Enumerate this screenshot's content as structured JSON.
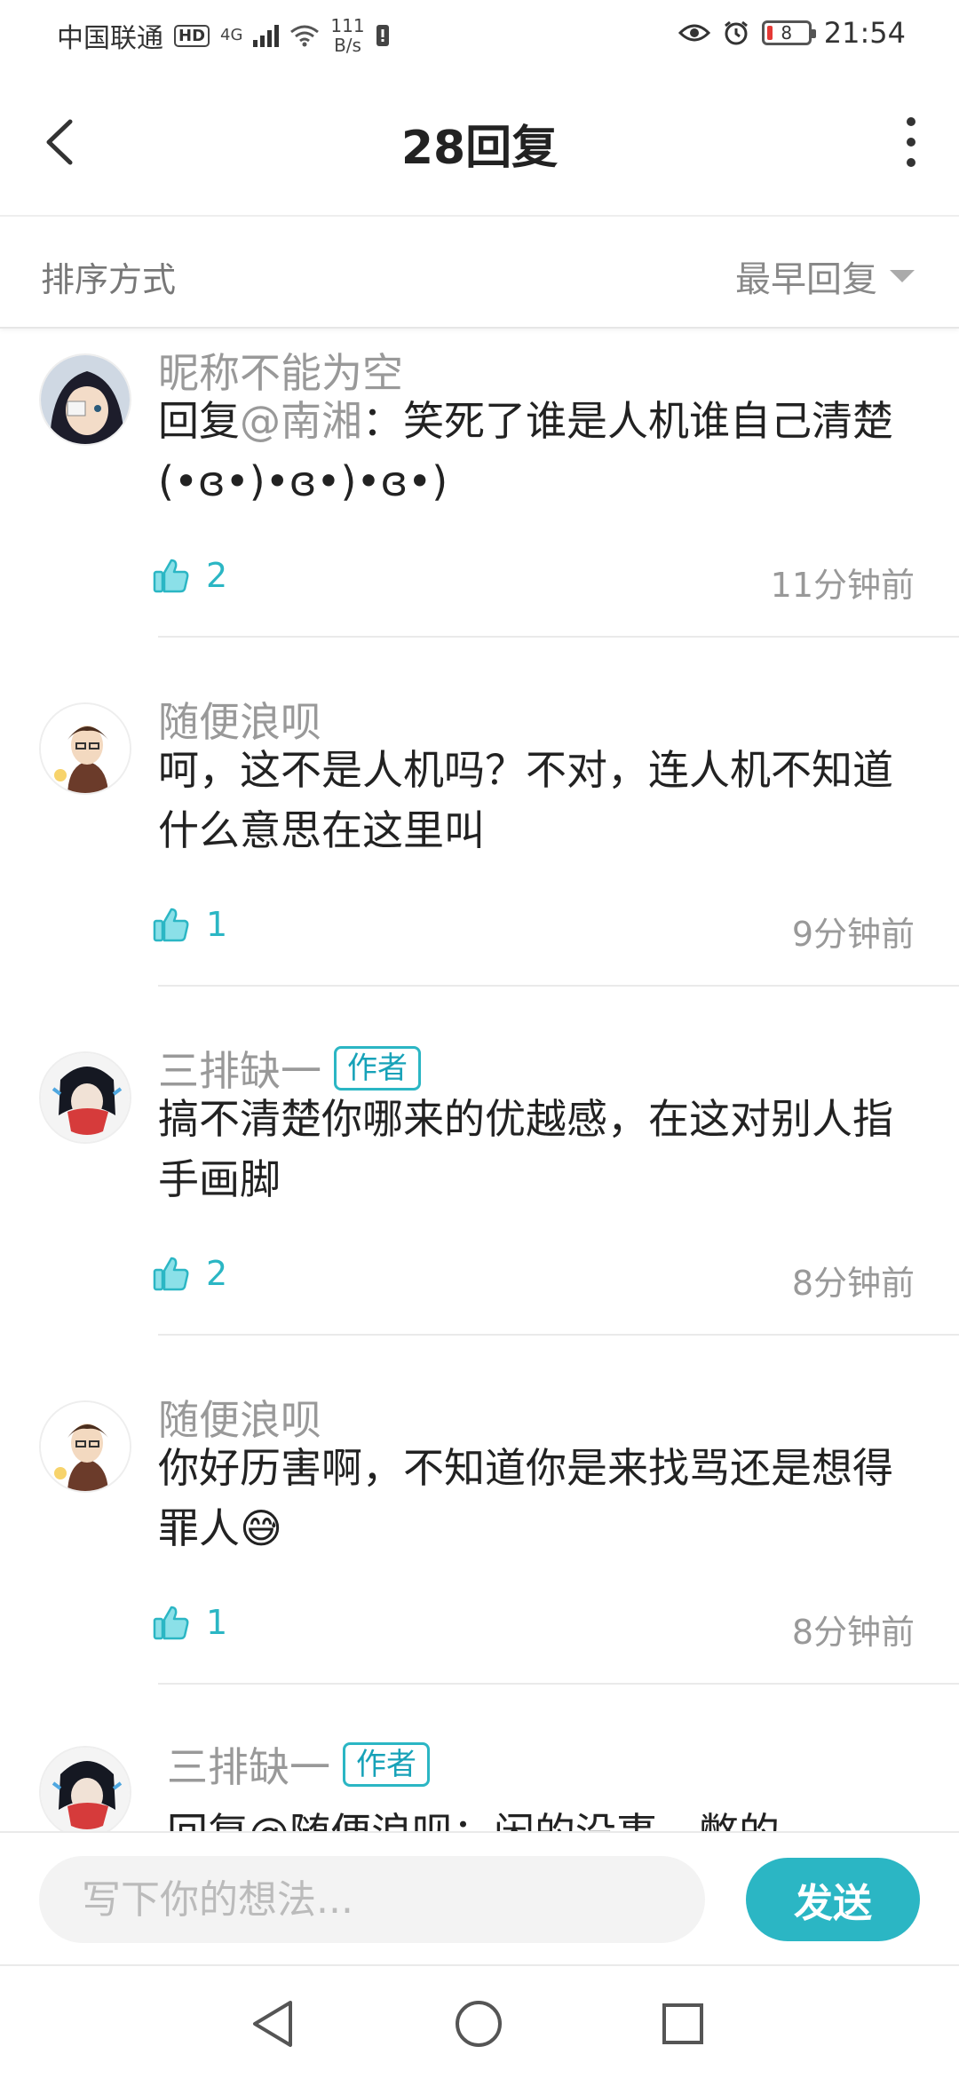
{
  "status_bar": {
    "carrier": "中国联通",
    "hd": "HD",
    "network": "4G",
    "speed_value": "111",
    "speed_unit": "B/s",
    "battery": "8",
    "time": "21:54"
  },
  "header": {
    "title": "28回复"
  },
  "sort": {
    "label": "排序方式",
    "selected": "最早回复"
  },
  "comments": [
    {
      "name": "昵称不能为空",
      "is_author": false,
      "reply_prefix": "回复",
      "mention": "@南湘",
      "text": "：笑死了谁是人机谁自己清楚(•ɞ•)•ɞ•)•ɞ•)",
      "likes": "2",
      "time": "11分钟前"
    },
    {
      "name": "随便浪呗",
      "is_author": false,
      "text": "呵，这不是人机吗？不对，连人机不知道什么意思在这里叫",
      "likes": "1",
      "time": "9分钟前"
    },
    {
      "name": "三排缺一",
      "is_author": true,
      "text": "搞不清楚你哪来的优越感，在这对别人指手画脚",
      "likes": "2",
      "time": "8分钟前"
    },
    {
      "name": "随便浪呗",
      "is_author": false,
      "text": "你好历害啊，不知道你是来找骂还是想得罪人😅",
      "likes": "1",
      "time": "8分钟前"
    },
    {
      "name": "三排缺一",
      "is_author": true,
      "text": "回复@随便浪呗：闲的没事，憋的",
      "likes": "",
      "time": ""
    }
  ],
  "author_badge": "作者",
  "input": {
    "placeholder": "写下你的想法...",
    "send_label": "发送"
  },
  "colors": {
    "accent": "#2bb6c4",
    "muted_text": "#999999",
    "body_text": "#222222"
  },
  "icons": {
    "back": "chevron-left-icon",
    "more": "more-vertical-icon",
    "like": "thumbs-up-icon",
    "nav_back": "triangle-back-icon",
    "nav_home": "circle-home-icon",
    "nav_recents": "square-recents-icon"
  }
}
